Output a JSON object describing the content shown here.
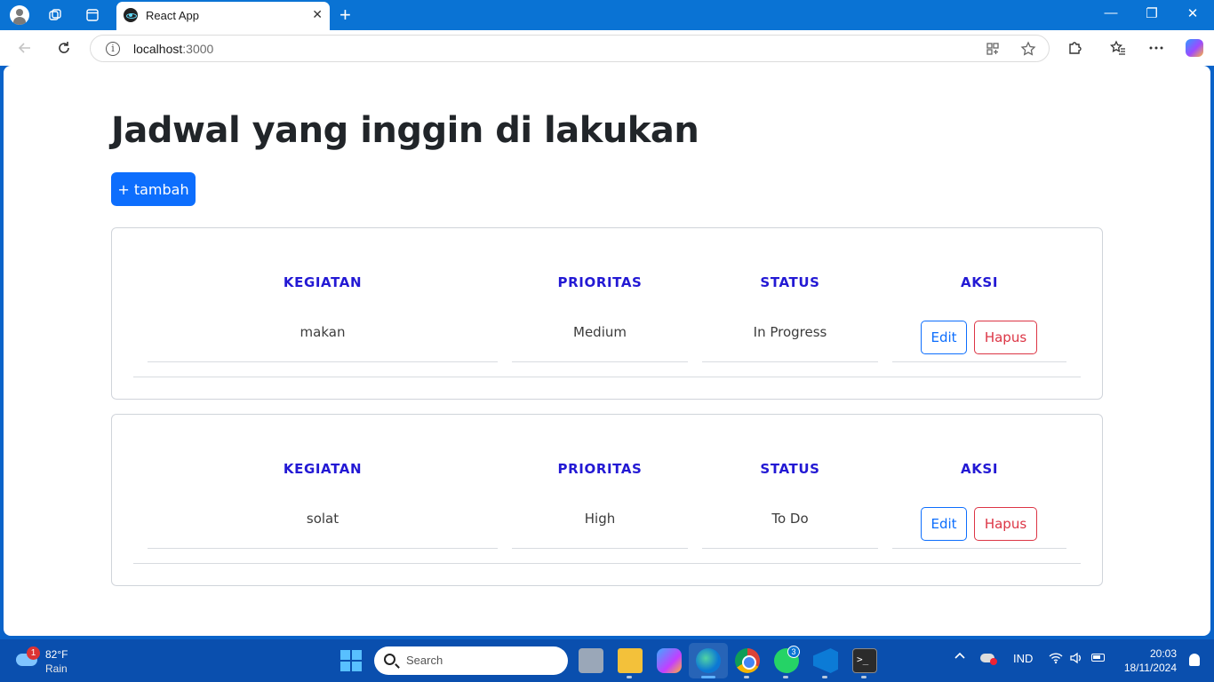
{
  "browser": {
    "tab_title": "React App",
    "url_host": "localhost",
    "url_port": ":3000",
    "new_tab_symbol": "+",
    "close_symbol": "✕",
    "window_controls": [
      "—",
      "❐",
      "✕"
    ]
  },
  "page": {
    "title": "Jadwal yang inggin di lakukan",
    "add_button": "+ tambah",
    "headers": {
      "kegiatan": "KEGIATAN",
      "prioritas": "PRIORITAS",
      "status": "STATUS",
      "aksi": "AKSI"
    },
    "edit_label": "Edit",
    "delete_label": "Hapus",
    "items": [
      {
        "kegiatan": "makan",
        "prioritas": "Medium",
        "status": "In Progress"
      },
      {
        "kegiatan": "solat",
        "prioritas": "High",
        "status": "To Do"
      }
    ]
  },
  "taskbar": {
    "weather_badge": "1",
    "temperature": "82°F",
    "weather": "Rain",
    "search_placeholder": "Search",
    "whatsapp_badge": "3",
    "language": "IND",
    "time": "20:03",
    "date": "18/11/2024"
  },
  "colors": {
    "accent": "#0d6efd",
    "danger": "#dc3545",
    "header_text": "#2319d4"
  }
}
